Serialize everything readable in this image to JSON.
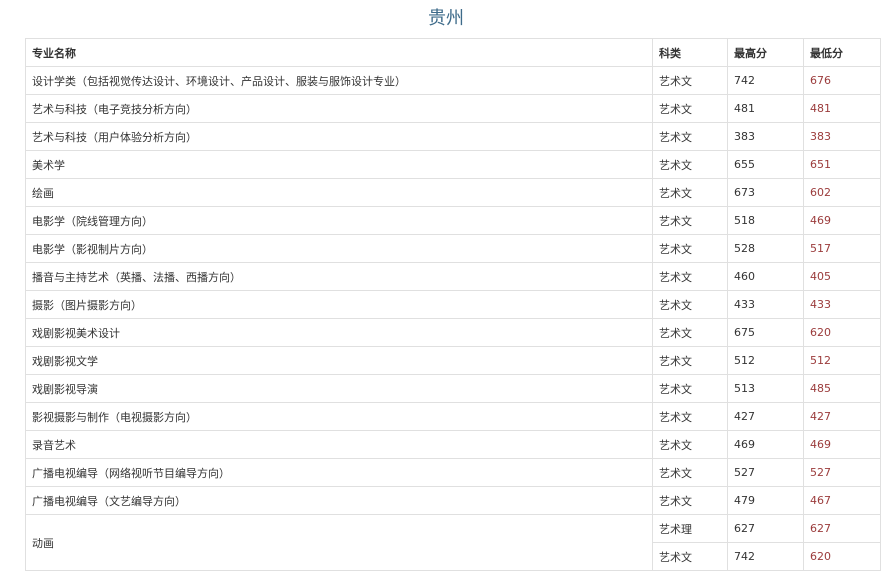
{
  "title": "贵州",
  "headers": [
    "专业名称",
    "科类",
    "最高分",
    "最低分"
  ],
  "rows": [
    {
      "major": "设计学类（包括视觉传达设计、环境设计、产品设计、服装与服饰设计专业）",
      "type": "艺术文",
      "max": "742",
      "min": "676"
    },
    {
      "major": "艺术与科技（电子竞技分析方向）",
      "type": "艺术文",
      "max": "481",
      "min": "481"
    },
    {
      "major": "艺术与科技（用户体验分析方向）",
      "type": "艺术文",
      "max": "383",
      "min": "383"
    },
    {
      "major": "美术学",
      "type": "艺术文",
      "max": "655",
      "min": "651"
    },
    {
      "major": "绘画",
      "type": "艺术文",
      "max": "673",
      "min": "602"
    },
    {
      "major": "电影学（院线管理方向）",
      "type": "艺术文",
      "max": "518",
      "min": "469"
    },
    {
      "major": "电影学（影视制片方向）",
      "type": "艺术文",
      "max": "528",
      "min": "517"
    },
    {
      "major": "播音与主持艺术（英播、法播、西播方向）",
      "type": "艺术文",
      "max": "460",
      "min": "405"
    },
    {
      "major": "摄影（图片摄影方向）",
      "type": "艺术文",
      "max": "433",
      "min": "433"
    },
    {
      "major": "戏剧影视美术设计",
      "type": "艺术文",
      "max": "675",
      "min": "620"
    },
    {
      "major": "戏剧影视文学",
      "type": "艺术文",
      "max": "512",
      "min": "512"
    },
    {
      "major": "戏剧影视导演",
      "type": "艺术文",
      "max": "513",
      "min": "485"
    },
    {
      "major": "影视摄影与制作（电视摄影方向）",
      "type": "艺术文",
      "max": "427",
      "min": "427"
    },
    {
      "major": "录音艺术",
      "type": "艺术文",
      "max": "469",
      "min": "469"
    },
    {
      "major": "广播电视编导（网络视听节目编导方向）",
      "type": "艺术文",
      "max": "527",
      "min": "527"
    },
    {
      "major": "广播电视编导（文艺编导方向）",
      "type": "艺术文",
      "max": "479",
      "min": "467"
    }
  ],
  "merged": {
    "major": "动画",
    "entries": [
      {
        "type": "艺术理",
        "max": "627",
        "min": "627"
      },
      {
        "type": "艺术文",
        "max": "742",
        "min": "620"
      }
    ]
  }
}
